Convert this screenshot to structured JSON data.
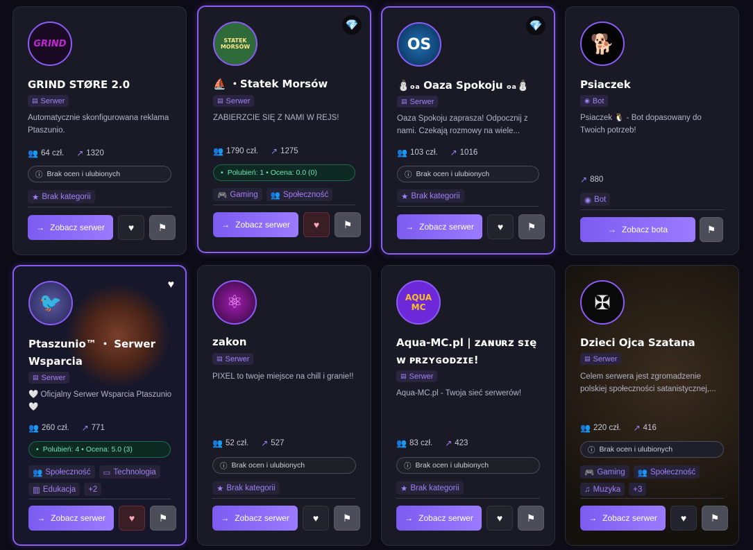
{
  "labels": {
    "view_server": "Zobacz serwer",
    "view_bot": "Zobacz bota",
    "no_ratings": "Brak ocen i ulubionych",
    "no_categories": "Brak kategorii",
    "members_suffix": "człon."
  },
  "cards": [
    {
      "avatar_text": "GRIND",
      "title": "GRIND STØRE 2.0",
      "type": "Serwer",
      "description": "Automatycznie skonfigurowana reklama Ptaszunio.",
      "members": "64 czł.",
      "growth": "1320",
      "rating": "Brak ocen i ulubionych",
      "categories": [
        "Brak kategorii"
      ],
      "button": "Zobacz serwer"
    },
    {
      "avatar_text": "STATEK MORSÓW",
      "title": "⛵ ・Statek Morsów",
      "type": "Serwer",
      "description": "ZABIERZCIE SIĘ Z NAMI W REJS!",
      "members": "1790 czł.",
      "growth": "1275",
      "rating": "Polubień: 1 • Ocena: 0.0 (0)",
      "categories": [
        "Gaming",
        "Społeczność"
      ],
      "button": "Zobacz serwer"
    },
    {
      "avatar_text": "OS",
      "title": "⛄ₒₐ Oaza Spokoju ₒₐ⛄",
      "type": "Serwer",
      "description": "Oaza Spokoju zaprasza! Odpocznij z nami. Czekają rozmowy na wiele...",
      "members": "103 czł.",
      "growth": "1016",
      "rating": "Brak ocen i ulubionych",
      "categories": [
        "Brak kategorii"
      ],
      "button": "Zobacz serwer"
    },
    {
      "avatar_text": "🐕",
      "title": "Psiaczek",
      "type": "Bot",
      "description": "Psiaczek 🐧 - Bot dopasowany do Twoich potrzeb!",
      "growth": "880",
      "categories": [
        "Bot"
      ],
      "button": "Zobacz bota"
    },
    {
      "avatar_text": "🐦",
      "title": "Ptaszunio™ ・ Serwer Wsparcia",
      "type": "Serwer",
      "description": "🤍 Oficjalny Serwer Wsparcia Ptaszunio 🤍",
      "members": "260 czł.",
      "growth": "771",
      "rating": "Polubień: 4 • Ocena: 5.0 (3)",
      "categories": [
        "Społeczność",
        "Technologia",
        "Edukacja",
        "+2"
      ],
      "button": "Zobacz serwer"
    },
    {
      "avatar_text": "⚛",
      "title": "zakon",
      "type": "Serwer",
      "description": "PIXEL to twoje miejsce na chill i granie!!",
      "members": "52 czł.",
      "growth": "527",
      "rating": "Brak ocen i ulubionych",
      "categories": [
        "Brak kategorii"
      ],
      "button": "Zobacz serwer"
    },
    {
      "avatar_text": "AQUA MC",
      "title": "Aqua-MC.pl | ᴢᴀɴᴜʀᴢ ꜱɪę ᴡ ᴘʀᴢʏɢᴏᴅᴢɪᴇ!",
      "type": "Serwer",
      "description": "Aqua-MC.pl - Twoja sieć serwerów!",
      "members": "83 czł.",
      "growth": "423",
      "rating": "Brak ocen i ulubionych",
      "categories": [
        "Brak kategorii"
      ],
      "button": "Zobacz serwer"
    },
    {
      "avatar_text": "✠",
      "title": "Dzieci Ojca Szatana",
      "type": "Serwer",
      "description": "Celem serwera jest zgromadzenie polskiej społeczności satanistycznej,...",
      "members": "220 czł.",
      "growth": "416",
      "rating": "Brak ocen i ulubionych",
      "categories": [
        "Gaming",
        "Społeczność",
        "Muzyka",
        "+3"
      ],
      "button": "Zobacz serwer"
    }
  ]
}
